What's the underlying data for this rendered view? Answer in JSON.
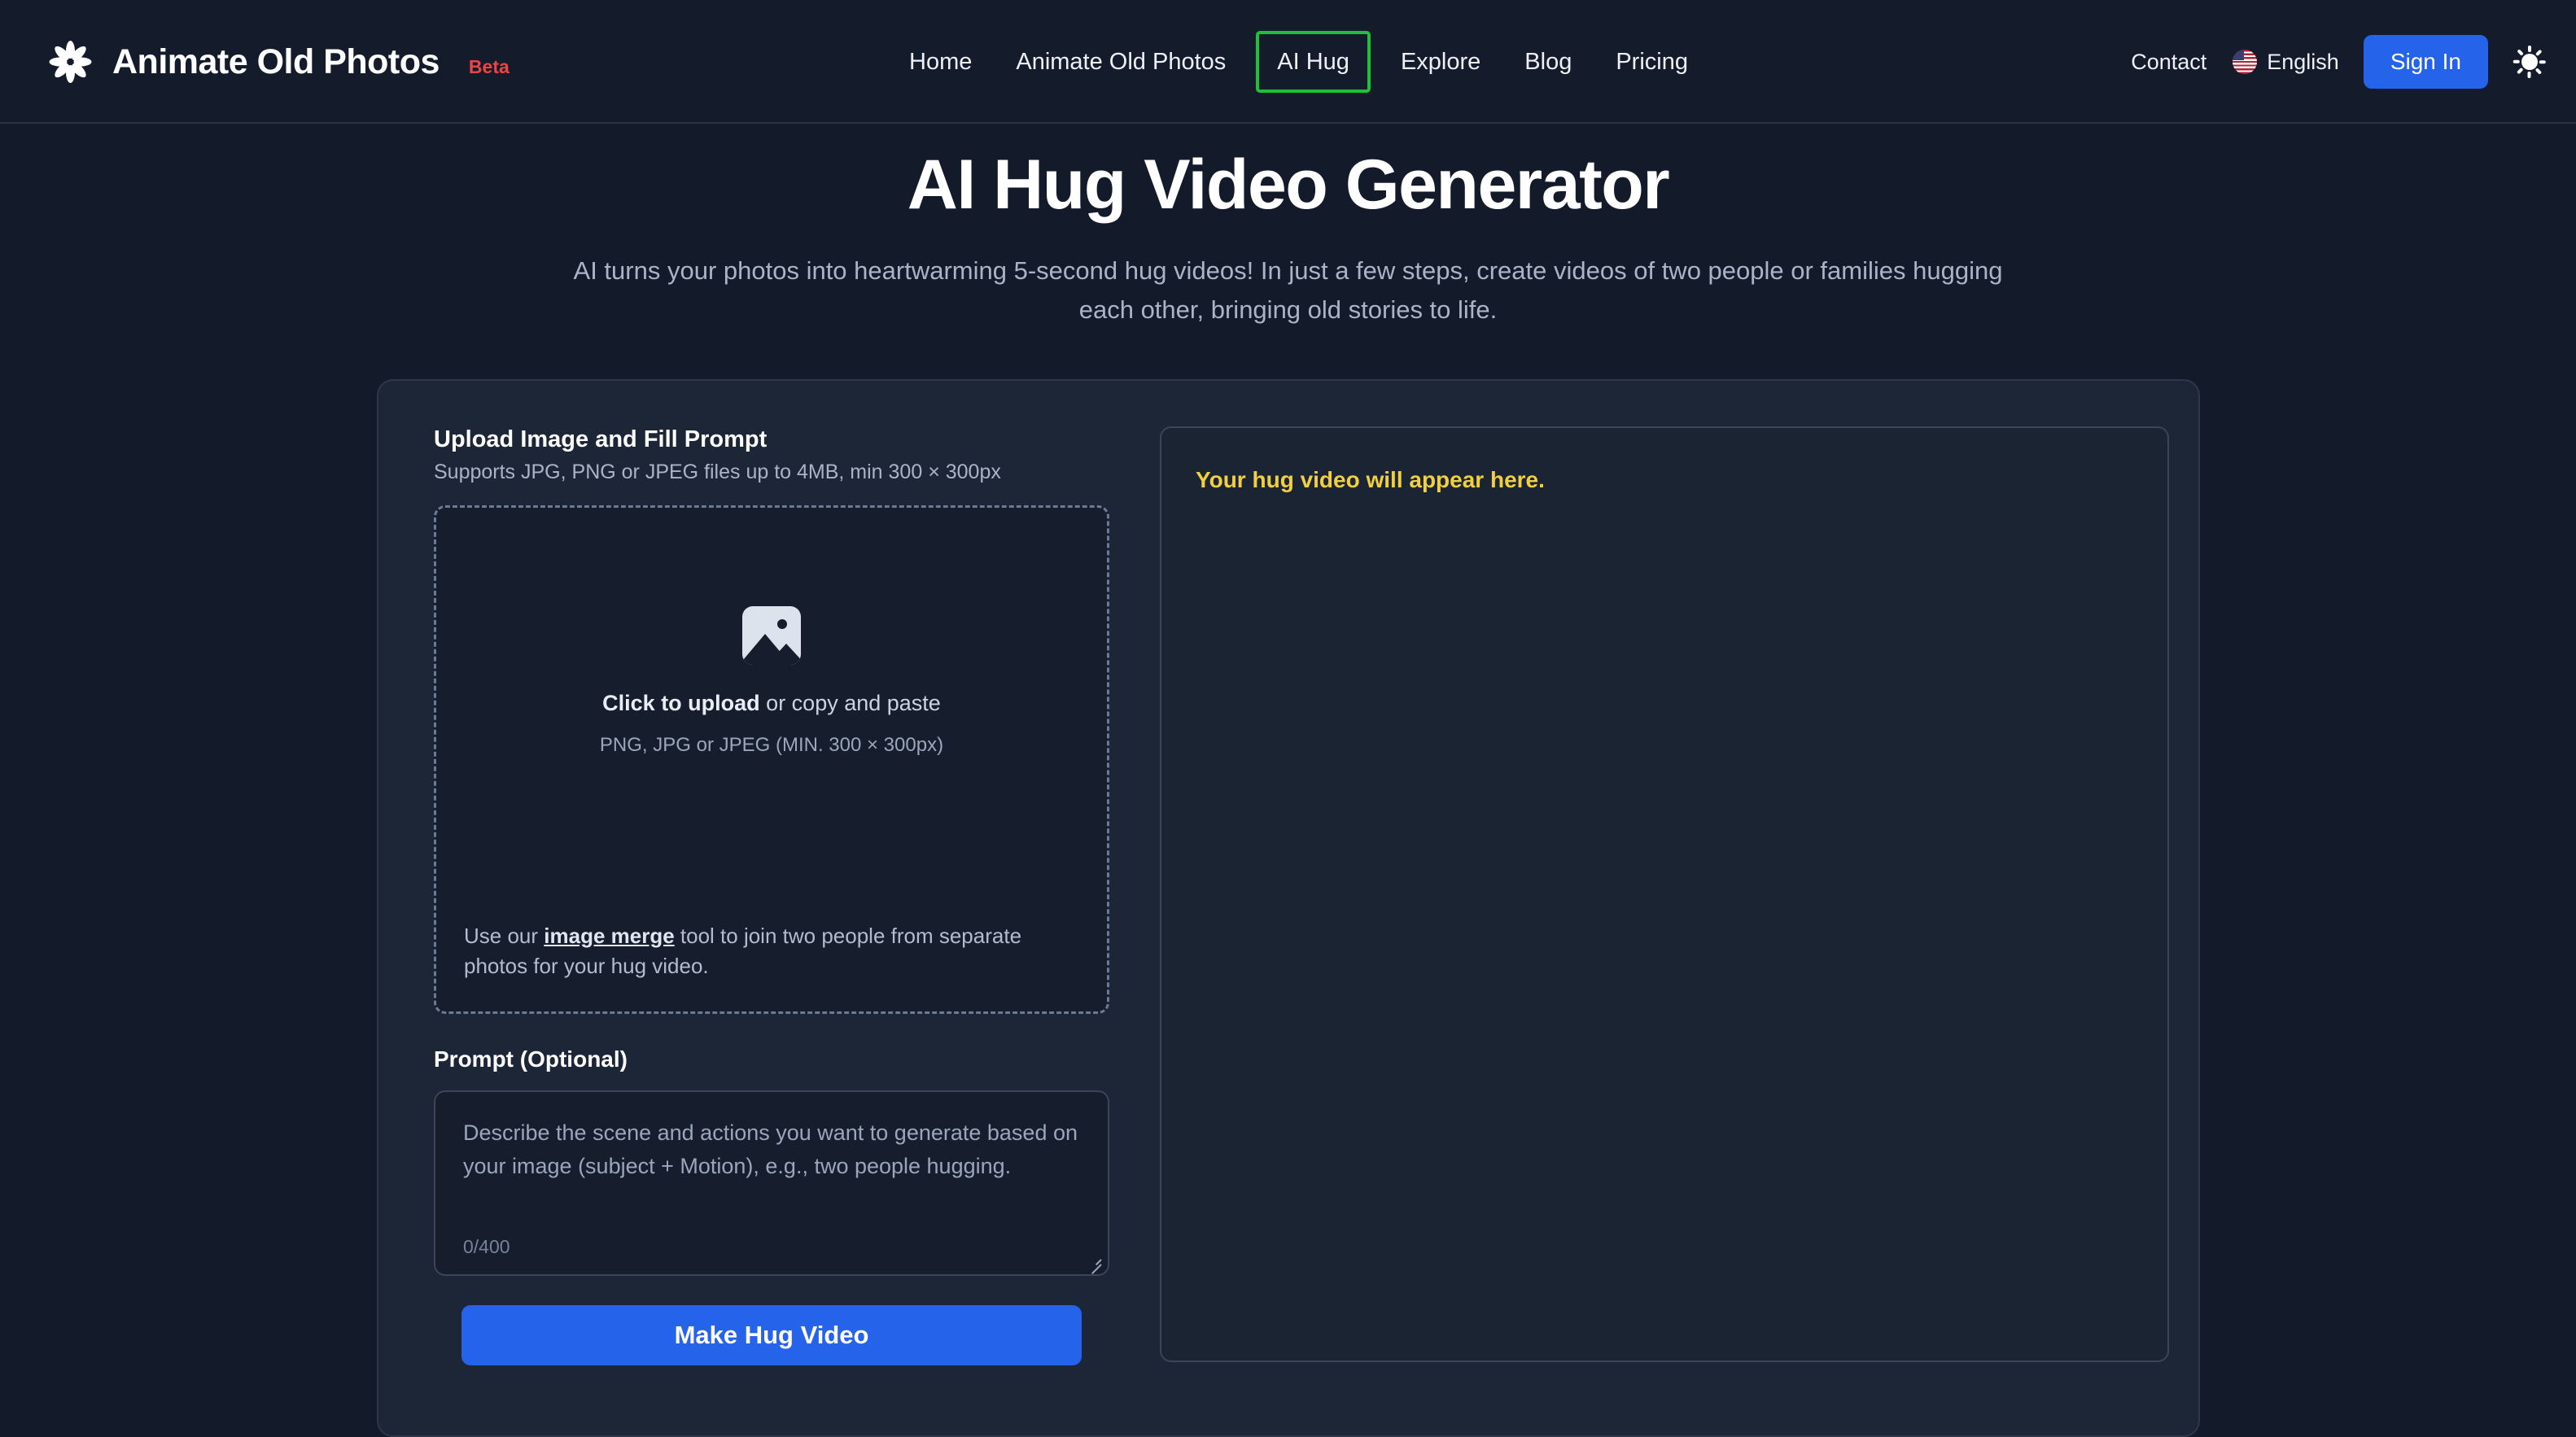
{
  "brand": {
    "name": "Animate Old Photos",
    "badge": "Beta",
    "logo_icon": "flower-logo-icon"
  },
  "nav": {
    "items": [
      {
        "label": "Home",
        "active": false
      },
      {
        "label": "Animate Old Photos",
        "active": false
      },
      {
        "label": "AI Hug",
        "active": true
      },
      {
        "label": "Explore",
        "active": false
      },
      {
        "label": "Blog",
        "active": false
      },
      {
        "label": "Pricing",
        "active": false
      }
    ],
    "active_outline_color": "#22c03a"
  },
  "header_right": {
    "contact_label": "Contact",
    "language_label": "English",
    "language_flag_icon": "us-flag-icon",
    "signin_label": "Sign In",
    "signin_color": "#2563eb",
    "theme_toggle_icon": "sun-icon"
  },
  "hero": {
    "title": "AI Hug Video Generator",
    "subtitle": "AI turns your photos into heartwarming 5-second hug videos! In just a few steps, create videos of two people or families hugging each other, bringing old stories to life."
  },
  "upload": {
    "section_title": "Upload Image and Fill Prompt",
    "section_subtitle": "Supports JPG, PNG or JPEG files up to 4MB, min 300 × 300px",
    "dropzone_icon": "image-placeholder-icon",
    "dropzone_main_strong": "Click to upload",
    "dropzone_main_rest": " or copy and paste",
    "dropzone_formats": "PNG, JPG or JPEG (MIN. 300 × 300px)",
    "note_prefix": "Use our ",
    "note_link": "image merge",
    "note_suffix": " tool to join two people from separate photos for your hug video."
  },
  "prompt": {
    "label": "Prompt (Optional)",
    "placeholder": "Describe the scene and actions you want to generate based on your image (subject + Motion), e.g., two people hugging.",
    "value": "",
    "counter": "0/400",
    "max_chars": 400
  },
  "actions": {
    "submit_label": "Make Hug Video"
  },
  "preview": {
    "message": "Your hug video will appear here.",
    "message_color": "#f2ce43"
  }
}
